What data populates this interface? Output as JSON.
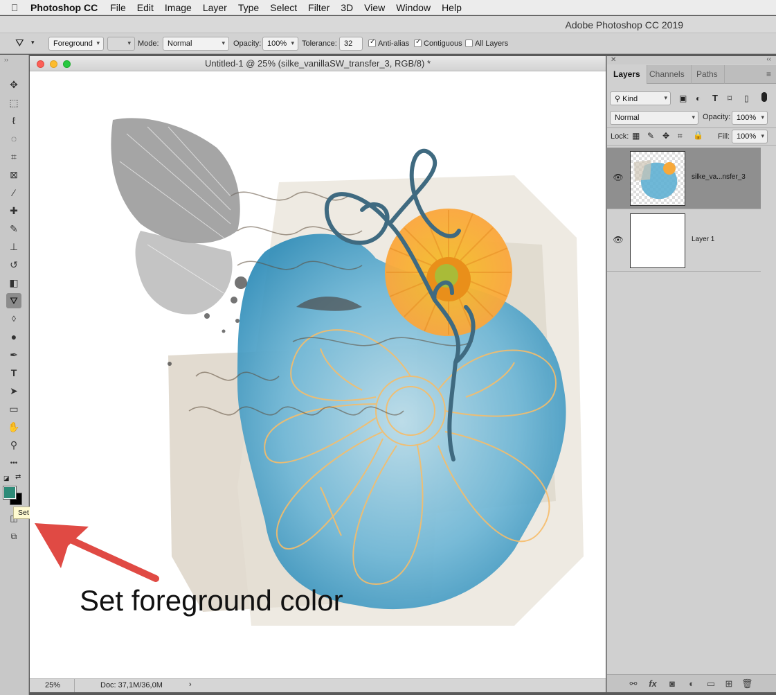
{
  "menubar": {
    "app_name": "Photoshop CC",
    "items": [
      "File",
      "Edit",
      "Image",
      "Layer",
      "Type",
      "Select",
      "Filter",
      "3D",
      "View",
      "Window",
      "Help"
    ]
  },
  "titlebar": {
    "app_title": "Adobe Photoshop CC 2019"
  },
  "options": {
    "fill_source": "Foreground",
    "mode_label": "Mode:",
    "mode_value": "Normal",
    "opacity_label": "Opacity:",
    "opacity_value": "100%",
    "tolerance_label": "Tolerance:",
    "tolerance_value": "32",
    "anti_alias_label": "Anti-alias",
    "anti_alias_checked": true,
    "contiguous_label": "Contiguous",
    "contiguous_checked": true,
    "all_layers_label": "All Layers",
    "all_layers_checked": false
  },
  "tools": [
    {
      "name": "move",
      "glyph": "✥",
      "active": false
    },
    {
      "name": "marquee",
      "glyph": "⬚",
      "active": false
    },
    {
      "name": "lasso",
      "glyph": "ℓ",
      "active": false
    },
    {
      "name": "quick-selection",
      "glyph": "◌",
      "active": false
    },
    {
      "name": "crop",
      "glyph": "⌗",
      "active": false
    },
    {
      "name": "frame",
      "glyph": "⊠",
      "active": false
    },
    {
      "name": "eyedropper",
      "glyph": "⁄",
      "active": false
    },
    {
      "name": "healing",
      "glyph": "✚",
      "active": false
    },
    {
      "name": "brush",
      "glyph": "✎",
      "active": false
    },
    {
      "name": "stamp",
      "glyph": "⊥",
      "active": false
    },
    {
      "name": "history-brush",
      "glyph": "↺",
      "active": false
    },
    {
      "name": "eraser",
      "glyph": "◧",
      "active": false
    },
    {
      "name": "paint-bucket",
      "glyph": "⛛",
      "active": true
    },
    {
      "name": "blur",
      "glyph": "💧",
      "active": false
    },
    {
      "name": "dodge",
      "glyph": "●",
      "active": false
    },
    {
      "name": "pen",
      "glyph": "✒",
      "active": false
    },
    {
      "name": "type",
      "glyph": "T",
      "active": false
    },
    {
      "name": "path-selection",
      "glyph": "➤",
      "active": false
    },
    {
      "name": "rectangle",
      "glyph": "▭",
      "active": false
    },
    {
      "name": "hand",
      "glyph": "✋",
      "active": false
    },
    {
      "name": "zoom",
      "glyph": "⚲",
      "active": false
    },
    {
      "name": "more",
      "glyph": "•••",
      "active": false
    }
  ],
  "colors": {
    "foreground": "#2e8b78",
    "background": "#000000",
    "arrow": "#e04a44",
    "watercolor": "#4aa3c9",
    "flower_orange": "#f7a93a",
    "swirl": "#3f6a80"
  },
  "document": {
    "title": "Untitled-1 @ 25% (silke_vanillaSW_transfer_3, RGB/8) *",
    "zoom": "25%",
    "doc_size": "Doc: 37,1M/36,0M"
  },
  "layers_panel": {
    "tabs": [
      "Layers",
      "Channels",
      "Paths"
    ],
    "kind_label": "Kind",
    "blend_mode": "Normal",
    "opacity_label": "Opacity:",
    "opacity_value": "100%",
    "lock_label": "Lock:",
    "fill_label": "Fill:",
    "fill_value": "100%",
    "layers": [
      {
        "name": "silke_va...nsfer_3",
        "selected": true
      },
      {
        "name": "Layer 1",
        "selected": false
      }
    ]
  },
  "tooltip": "Set foreground color",
  "annotation": "Set foreground color"
}
